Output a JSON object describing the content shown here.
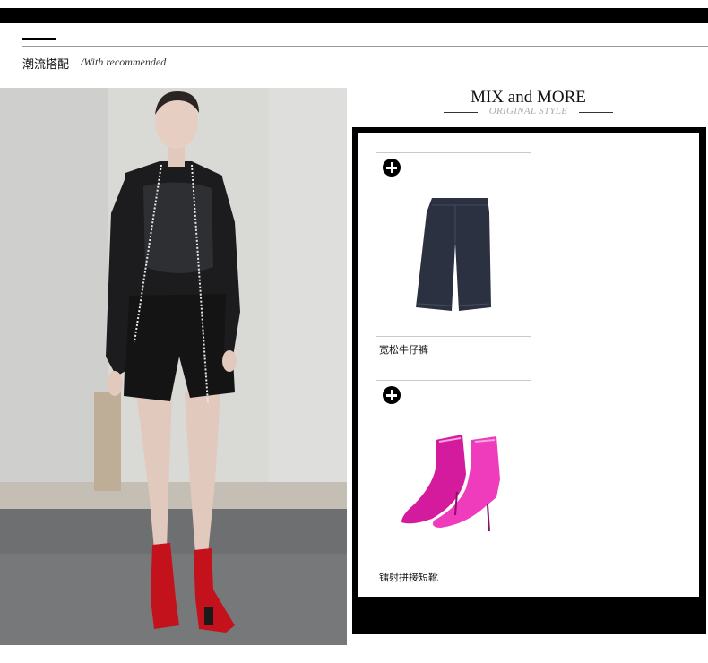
{
  "section": {
    "title": "潮流搭配",
    "subtitle": "/With recommended"
  },
  "mix": {
    "title": "MIX and MORE",
    "subtitle": "ORIGINAL STYLE"
  },
  "products": [
    {
      "name": "宽松牛仔裤",
      "icon": "plus-circle-icon"
    },
    {
      "name": "镭射拼接短靴",
      "icon": "plus-circle-icon"
    }
  ],
  "colors": {
    "frame": "#000000",
    "denim": "#2b3140",
    "boot_pink": "#e11fa8",
    "model_boot_red": "#c3121b"
  }
}
